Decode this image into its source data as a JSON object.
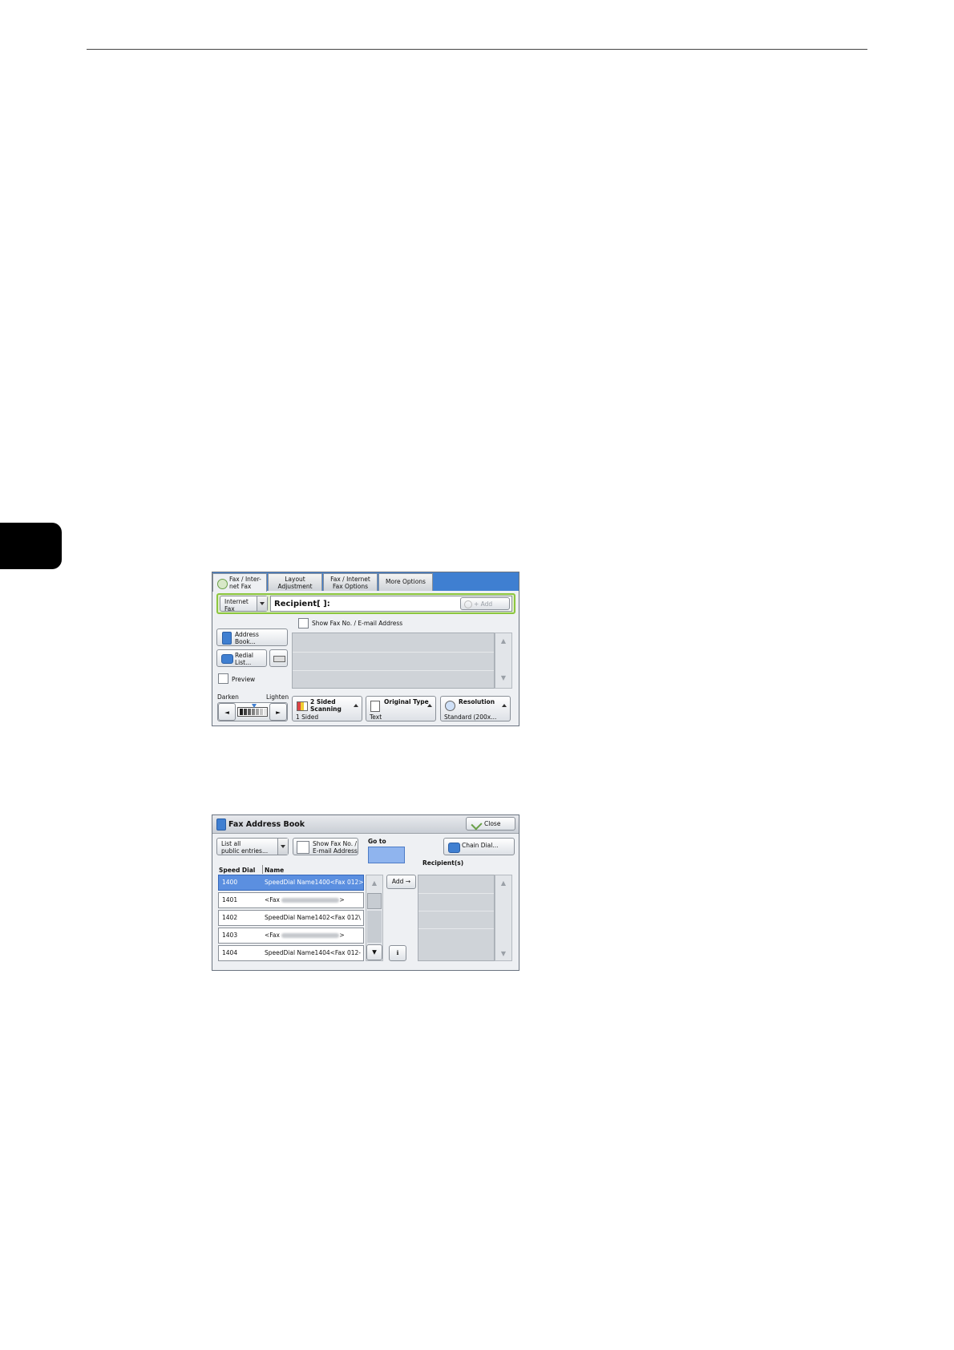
{
  "screen1": {
    "tabs": [
      {
        "line1": "Fax / Inter-",
        "line2": "net Fax"
      },
      {
        "line1": "Layout",
        "line2": "Adjustment"
      },
      {
        "line1": "Fax / Internet",
        "line2": "Fax Options"
      },
      {
        "line1": "More Options",
        "line2": ""
      }
    ],
    "fax_type": {
      "line1": "Internet",
      "line2": "Fax"
    },
    "recipient_label": "Recipient[   ]:",
    "add_label": "+ Add",
    "show_fax_label": "Show Fax No. / E-mail Address",
    "address_book": {
      "line1": "Address",
      "line2": "Book..."
    },
    "redial": {
      "line1": "Redial",
      "line2": "List..."
    },
    "preview_label": "Preview",
    "darken_label": "Darken",
    "lighten_label": "Lighten",
    "two_sided": {
      "title1": "2 Sided",
      "title2": "Scanning",
      "value": "1 Sided"
    },
    "original_type": {
      "title": "Original Type",
      "value": "Text"
    },
    "resolution": {
      "title": "Resolution",
      "value": "Standard (200x..."
    },
    "density_level": 0.5
  },
  "screen2": {
    "title": "Fax Address Book",
    "close_label": "Close",
    "list_filter": {
      "line1": "List all",
      "line2": "public entries..."
    },
    "show_fax": {
      "line1": "Show Fax No. /",
      "line2": "E-mail Address"
    },
    "go_to_label": "Go to",
    "chain_dial_label": "Chain Dial...",
    "recipients_label": "Recipient(s)",
    "col_speed_dial": "Speed Dial",
    "col_name": "Name",
    "add_label": "Add →",
    "rows": [
      {
        "dial": "1400",
        "name": "SpeedDial Name1400<Fax  012>",
        "blurred": false
      },
      {
        "dial": "1401",
        "name": "<Fax",
        "blurred": true,
        "suffix": ">"
      },
      {
        "dial": "1402",
        "name": "SpeedDial Name1402<Fax  012\\",
        "blurred": false
      },
      {
        "dial": "1403",
        "name": "<Fax",
        "blurred": true,
        "suffix": ">"
      },
      {
        "dial": "1404",
        "name": "SpeedDial Name1404<Fax  012-",
        "blurred": false
      }
    ]
  }
}
